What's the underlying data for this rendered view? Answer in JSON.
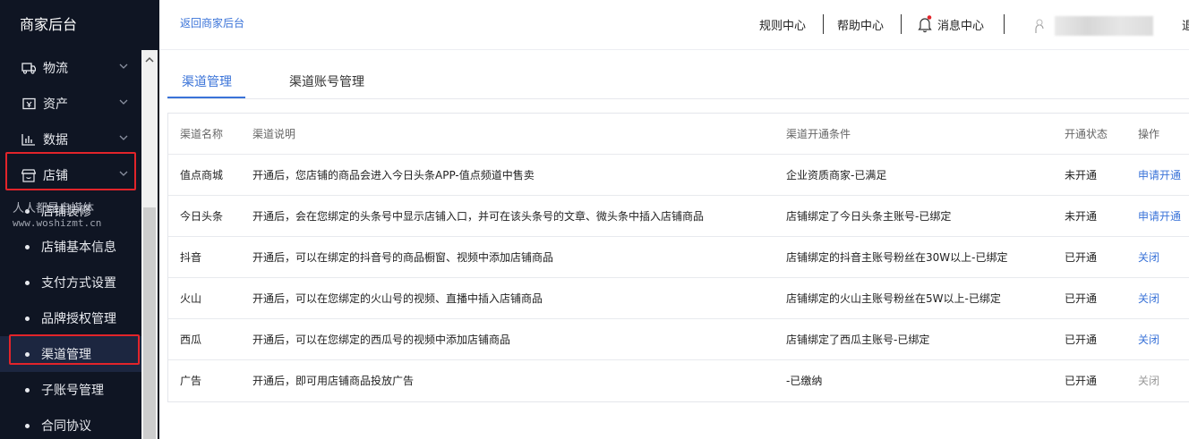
{
  "sidebar": {
    "title": "商家后台",
    "menu": [
      {
        "label": "物流",
        "icon": "truck-icon"
      },
      {
        "label": "资产",
        "icon": "wallet-icon"
      },
      {
        "label": "数据",
        "icon": "bar-chart-icon"
      },
      {
        "label": "店铺",
        "icon": "store-icon"
      }
    ],
    "submenu": [
      {
        "label": "店铺装修"
      },
      {
        "label": "店铺基本信息"
      },
      {
        "label": "支付方式设置"
      },
      {
        "label": "品牌授权管理"
      },
      {
        "label": "渠道管理"
      },
      {
        "label": "子账号管理"
      },
      {
        "label": "合同协议"
      }
    ],
    "watermark": {
      "line1": "人人都是自媒体",
      "line2": "www.woshizmt.cn"
    }
  },
  "header": {
    "back_link": "返回商家后台",
    "nav": [
      "规则中心",
      "帮助中心",
      "消息中心"
    ],
    "logout_partial": "退"
  },
  "tabs": [
    {
      "label": "渠道管理",
      "active": true
    },
    {
      "label": "渠道账号管理",
      "active": false
    }
  ],
  "table": {
    "headers": [
      "渠道名称",
      "渠道说明",
      "渠道开通条件",
      "开通状态",
      "操作"
    ],
    "rows": [
      {
        "name": "值点商城",
        "desc": "开通后，您店铺的商品会进入今日头条APP-值点频道中售卖",
        "cond": "企业资质商家-已满足",
        "status": "未开通",
        "action": "申请开通"
      },
      {
        "name": "今日头条",
        "desc": "开通后，会在您绑定的头条号中显示店铺入口，并可在该头条号的文章、微头条中插入店铺商品",
        "cond": "店铺绑定了今日头条主账号-已绑定",
        "status": "未开通",
        "action": "申请开通"
      },
      {
        "name": "抖音",
        "desc": "开通后，可以在绑定的抖音号的商品橱窗、视频中添加店铺商品",
        "cond": "店铺绑定的抖音主账号粉丝在30W以上-已绑定",
        "status": "已开通",
        "action": "关闭"
      },
      {
        "name": "火山",
        "desc": "开通后，可以在您绑定的火山号的视频、直播中插入店铺商品",
        "cond": "店铺绑定的火山主账号粉丝在5W以上-已绑定",
        "status": "已开通",
        "action": "关闭"
      },
      {
        "name": "西瓜",
        "desc": "开通后，可以在您绑定的西瓜号的视频中添加店铺商品",
        "cond": "店铺绑定了西瓜主账号-已绑定",
        "status": "已开通",
        "action": "关闭"
      },
      {
        "name": "广告",
        "desc": "开通后，即可用店铺商品投放广告",
        "cond": "-已缴纳",
        "status": "已开通",
        "action": "关闭"
      }
    ]
  },
  "colors": {
    "accent": "#3a73d8",
    "sidebar_bg": "#0f1523",
    "highlight": "#e2242a"
  }
}
